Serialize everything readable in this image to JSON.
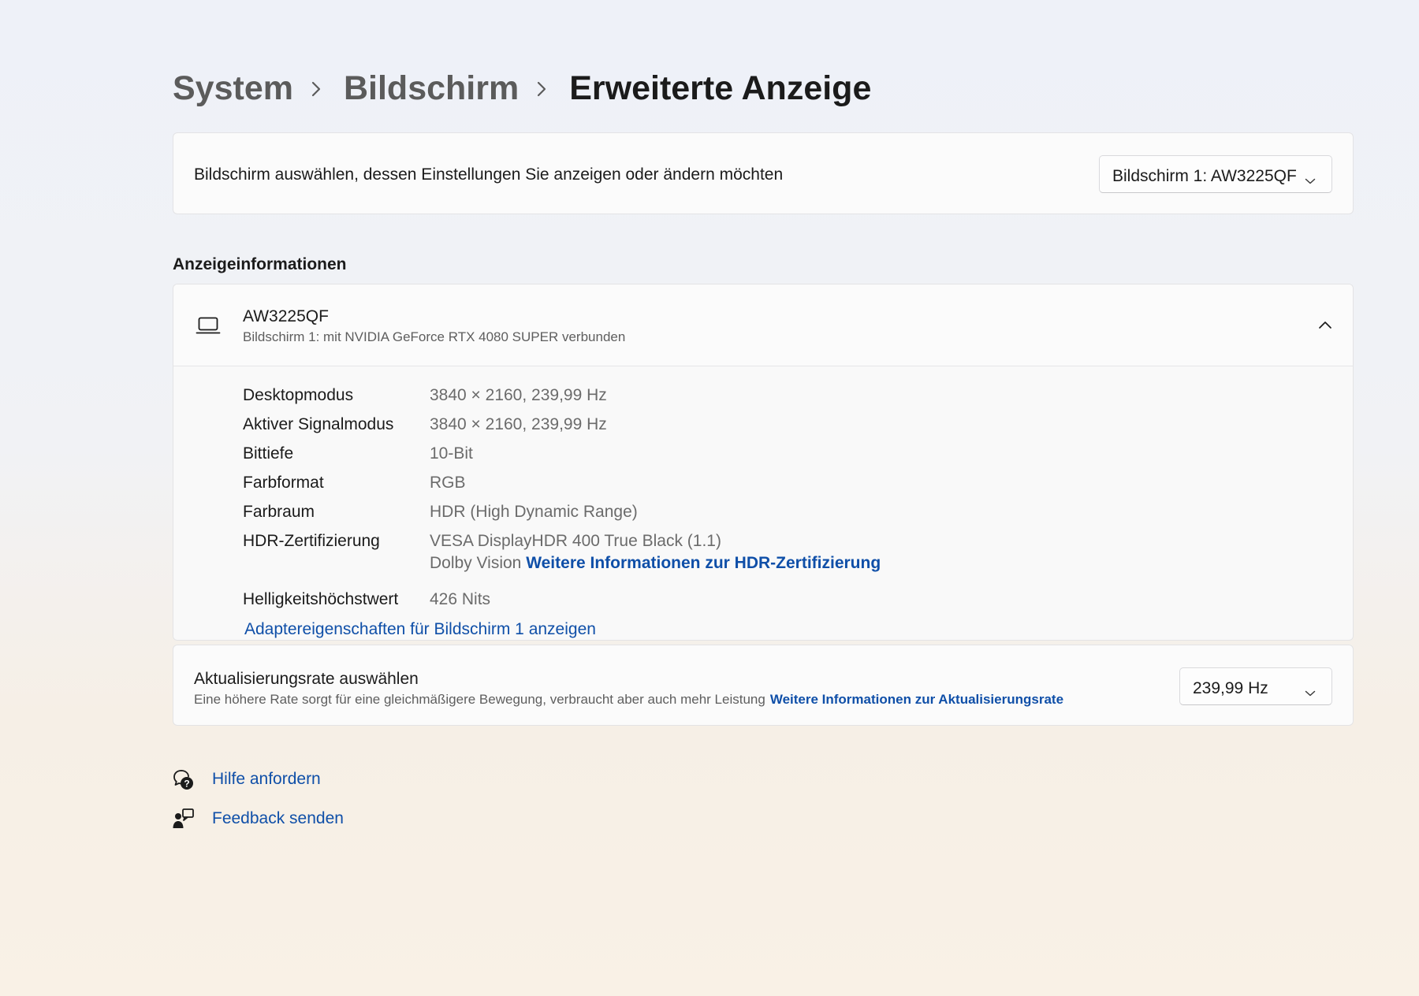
{
  "breadcrumb": {
    "items": [
      "System",
      "Bildschirm"
    ],
    "current": "Erweiterte Anzeige"
  },
  "display_select": {
    "label": "Bildschirm auswählen, dessen Einstellungen Sie anzeigen oder ändern möchten",
    "selected": "Bildschirm 1: AW3225QF"
  },
  "display_info": {
    "section_title": "Anzeigeinformationen",
    "monitor_name": "AW3225QF",
    "monitor_subtitle": "Bildschirm 1: mit NVIDIA GeForce RTX 4080 SUPER verbunden",
    "rows": [
      {
        "label": "Desktopmodus",
        "value": "3840 × 2160, 239,99 Hz"
      },
      {
        "label": "Aktiver Signalmodus",
        "value": "3840 × 2160, 239,99 Hz"
      },
      {
        "label": "Bittiefe",
        "value": "10-Bit"
      },
      {
        "label": "Farbformat",
        "value": "RGB"
      },
      {
        "label": "Farbraum",
        "value": "HDR (High Dynamic Range)"
      },
      {
        "label": "HDR-Zertifizierung",
        "value": "VESA DisplayHDR 400 True Black (1.1)",
        "value2": "Dolby Vision",
        "link": "Weitere Informationen zur HDR-Zertifizierung"
      },
      {
        "label": "Helligkeitshöchstwert",
        "value": "426 Nits"
      }
    ],
    "adapter_link": "Adaptereigenschaften für Bildschirm 1 anzeigen"
  },
  "refresh_rate": {
    "title": "Aktualisierungsrate auswählen",
    "description": "Eine höhere Rate sorgt für eine gleichmäßigere Bewegung, verbraucht aber auch mehr Leistung",
    "link": "Weitere Informationen zur Aktualisierungsrate",
    "selected": "239,99 Hz"
  },
  "footer": {
    "help": "Hilfe anfordern",
    "feedback": "Feedback senden"
  },
  "icons": {
    "breadcrumb_separator": "chevron-right-icon",
    "dropdown": "chevron-down-icon",
    "collapse": "chevron-up-icon",
    "monitor": "laptop-icon",
    "help": "help-chat-icon",
    "feedback": "feedback-icon"
  },
  "colors": {
    "link": "#0f4fa8",
    "card": "#fbfbfb",
    "secondary_text": "#6b6b6b"
  }
}
